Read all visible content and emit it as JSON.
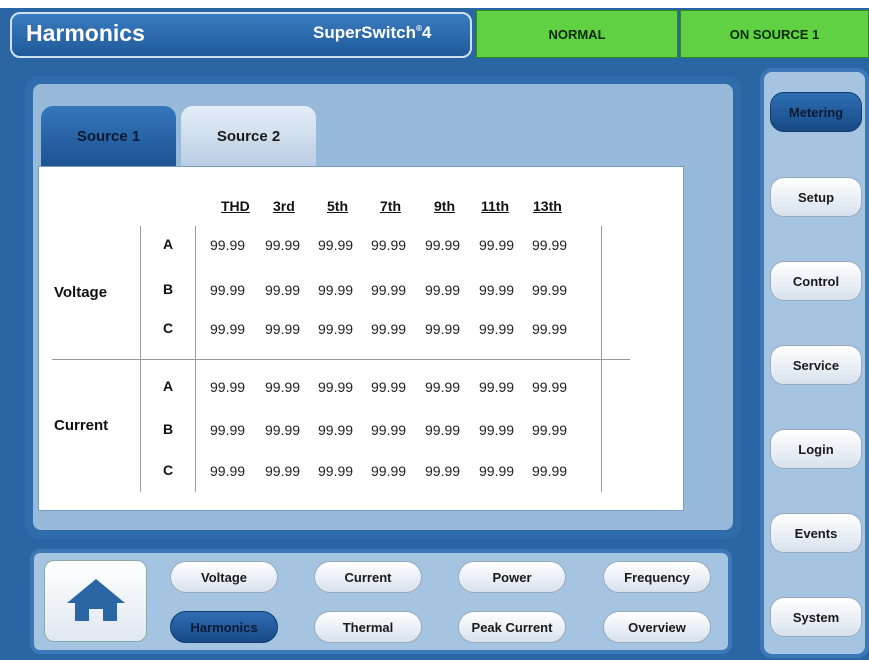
{
  "header": {
    "title": "Harmonics",
    "brand": "SuperSwitch",
    "brand_sup": "®",
    "brand_suffix": "4",
    "status": "NORMAL",
    "source_status": "ON SOURCE 1",
    "status_color": "#5fd142"
  },
  "tabs": [
    {
      "label": "Source 1",
      "active": true
    },
    {
      "label": "Source 2",
      "active": false
    }
  ],
  "table": {
    "columns": [
      "THD",
      "3rd",
      "5th",
      "7th",
      "9th",
      "11th",
      "13th"
    ],
    "groups": [
      {
        "label": "Voltage",
        "rows": [
          {
            "phase": "A",
            "values": [
              "99.99",
              "99.99",
              "99.99",
              "99.99",
              "99.99",
              "99.99",
              "99.99"
            ]
          },
          {
            "phase": "B",
            "values": [
              "99.99",
              "99.99",
              "99.99",
              "99.99",
              "99.99",
              "99.99",
              "99.99"
            ]
          },
          {
            "phase": "C",
            "values": [
              "99.99",
              "99.99",
              "99.99",
              "99.99",
              "99.99",
              "99.99",
              "99.99"
            ]
          }
        ]
      },
      {
        "label": "Current",
        "rows": [
          {
            "phase": "A",
            "values": [
              "99.99",
              "99.99",
              "99.99",
              "99.99",
              "99.99",
              "99.99",
              "99.99"
            ]
          },
          {
            "phase": "B",
            "values": [
              "99.99",
              "99.99",
              "99.99",
              "99.99",
              "99.99",
              "99.99",
              "99.99"
            ]
          },
          {
            "phase": "C",
            "values": [
              "99.99",
              "99.99",
              "99.99",
              "99.99",
              "99.99",
              "99.99",
              "99.99"
            ]
          }
        ]
      }
    ]
  },
  "bottom_nav": {
    "home_icon": "home-icon",
    "row1": [
      "Voltage",
      "Current",
      "Power",
      "Frequency"
    ],
    "row2": [
      "Harmonics",
      "Thermal",
      "Peak Current",
      "Overview"
    ],
    "active": "Harmonics"
  },
  "sidebar": {
    "items": [
      "Metering",
      "Setup",
      "Control",
      "Service",
      "Login",
      "Events",
      "System"
    ],
    "active": "Metering"
  }
}
